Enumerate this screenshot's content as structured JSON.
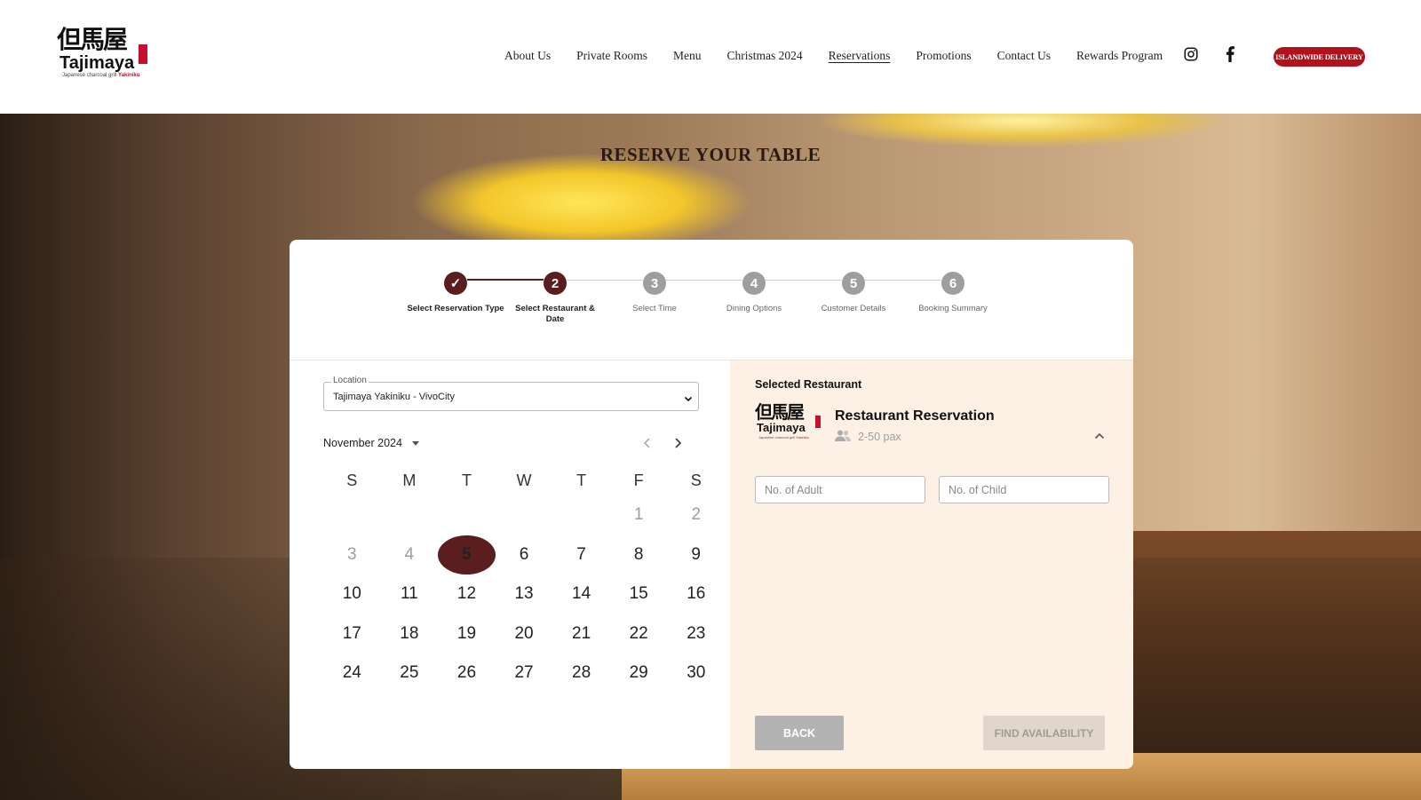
{
  "brand": {
    "kanji": "但馬屋",
    "name": "Tajimaya",
    "tagline_prefix": "Japanese charcoal grill",
    "tagline_accent": "Yakiniku"
  },
  "nav": {
    "items": [
      {
        "label": "About Us"
      },
      {
        "label": "Private Rooms"
      },
      {
        "label": "Menu"
      },
      {
        "label": "Christmas 2024"
      },
      {
        "label": "Reservations",
        "active": true
      },
      {
        "label": "Promotions"
      },
      {
        "label": "Contact Us"
      },
      {
        "label": "Rewards Program"
      }
    ],
    "delivery_label": "ISLANDWIDE DELIVERY"
  },
  "hero": {
    "title": "RESERVE YOUR TABLE"
  },
  "steps": [
    {
      "number": "✓",
      "label": "Select Reservation Type",
      "state": "done"
    },
    {
      "number": "2",
      "label": "Select Restaurant & Date",
      "state": "active"
    },
    {
      "number": "3",
      "label": "Select Time",
      "state": "pending"
    },
    {
      "number": "4",
      "label": "Dining Options",
      "state": "pending"
    },
    {
      "number": "5",
      "label": "Customer Details",
      "state": "pending"
    },
    {
      "number": "6",
      "label": "Booking Summary",
      "state": "pending"
    }
  ],
  "location": {
    "legend": "Location",
    "value": "Tajimaya Yakiniku - VivoCity"
  },
  "calendar": {
    "month_label": "November 2024",
    "weekdays": [
      "S",
      "M",
      "T",
      "W",
      "T",
      "F",
      "S"
    ],
    "weeks": [
      [
        null,
        null,
        null,
        null,
        null,
        "1",
        "2"
      ],
      [
        "3",
        "4",
        "5",
        "6",
        "7",
        "8",
        "9"
      ],
      [
        "10",
        "11",
        "12",
        "13",
        "14",
        "15",
        "16"
      ],
      [
        "17",
        "18",
        "19",
        "20",
        "21",
        "22",
        "23"
      ],
      [
        "24",
        "25",
        "26",
        "27",
        "28",
        "29",
        "30"
      ]
    ],
    "muted_days": [
      "1",
      "2",
      "3",
      "4"
    ],
    "selected_day": "5"
  },
  "selected": {
    "heading": "Selected Restaurant",
    "title": "Restaurant Reservation",
    "pax": "2-50 pax",
    "adult_placeholder": "No. of Adult",
    "child_placeholder": "No. of Child"
  },
  "buttons": {
    "back": "BACK",
    "find": "FIND AVAILABILITY"
  },
  "colors": {
    "accent": "#5a1e1e",
    "delivery": "#b0121b",
    "panel": "#fdf0e4"
  }
}
